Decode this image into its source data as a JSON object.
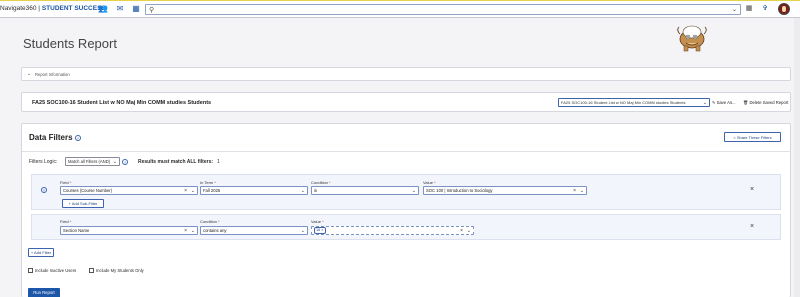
{
  "topbar": {
    "brand_name": "Navigate360",
    "brand_sep": " | ",
    "brand_product": "STUDENT SUCCESS",
    "search_placeholder": "",
    "icons": [
      "people-icon",
      "mail-icon",
      "calendar-icon",
      "search-icon",
      "grid-icon",
      "pin-icon"
    ]
  },
  "page": {
    "title": "Students Report"
  },
  "report_info": {
    "label": "Report Information"
  },
  "saved_report": {
    "name": "FA25 SOC100-16 Student List w NO Maj Min COMM studies Students",
    "selected": "FA25 SOC100-16 Student List w NO Maj Min COMM studies Students",
    "save_as": "Save As...",
    "delete": "Delete Saved Report"
  },
  "data_filters": {
    "title": "Data Filters",
    "share_button": "Share These Filters",
    "logic_label": "Filters Logic:",
    "logic_value": "Match all Filters (AND)",
    "must_match": "Results must match ALL filters:",
    "must_match_mark": "1",
    "filter1": {
      "field_label": "Field",
      "field_value": "Courses (Course Number)",
      "term_label": "In Term",
      "term_value": "Fall 2025",
      "condition_label": "Condition",
      "condition_value": "is",
      "value_label": "Value",
      "value_value": "SOC 100 | Introduction to Sociology",
      "sub_filter_button": "+ Add Sub-Filter"
    },
    "filter2": {
      "field_label": "Field",
      "field_value": "Section Name",
      "condition_label": "Condition",
      "condition_value": "contains any",
      "value_label": "Value",
      "value_tag": "16 ×"
    },
    "add_filter_button": "+ Add Filter",
    "include_inactive": "Include Inactive Users",
    "include_my_students": "Include My Students Only",
    "run_button": "Run Report"
  },
  "colors": {
    "accent": "#1c56a8",
    "required": "#c0392b",
    "group_bg": "#f2f5fb"
  }
}
